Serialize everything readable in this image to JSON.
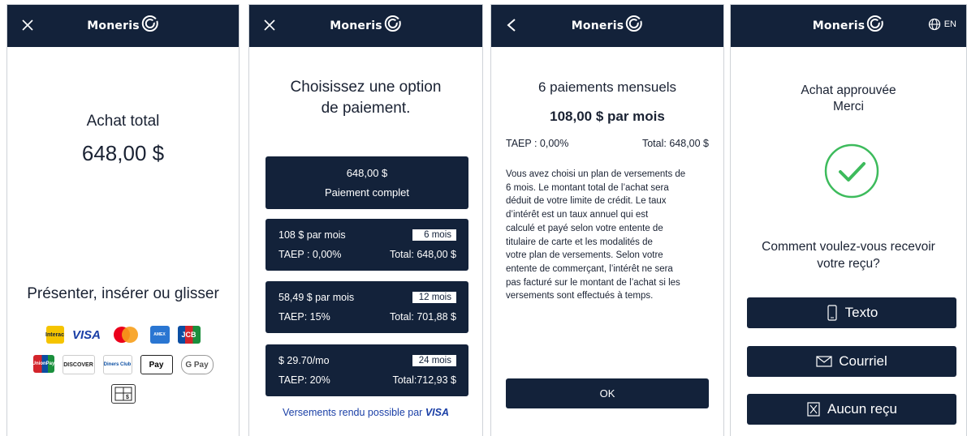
{
  "brand": {
    "name": "Moneris"
  },
  "screen1": {
    "total_label": "Achat total",
    "total_amount": "648,00 $",
    "instruction": "Présenter, insérer ou glisser",
    "card_logos": [
      "Interac",
      "VISA",
      "Mastercard",
      "American Express",
      "JCB",
      "UnionPay",
      "DISCOVER",
      "Diners Club",
      "Apple Pay",
      "G Pay",
      "Gift card"
    ]
  },
  "screen2": {
    "title_line1": "Choisissez une option",
    "title_line2": "de paiement.",
    "full": {
      "amount": "648,00 $",
      "label": "Paiement   complet"
    },
    "options": [
      {
        "monthly": "108 $ par mois",
        "months": "6 mois",
        "rate": "TAEP : 0,00%",
        "total": "Total: 648,00 $"
      },
      {
        "monthly": "58,49 $ par mois",
        "months": "12 mois",
        "rate": "TAEP: 15%",
        "total": "Total: 701,88 $"
      },
      {
        "monthly": "$ 29.70/mo",
        "months": "24 mois",
        "rate": "TAEP: 20%",
        "total": "Total:712,93  $"
      }
    ],
    "footer": "Versements rendu possible par",
    "footer_brand": "VISA"
  },
  "screen3": {
    "title": "6 paiements mensuels",
    "amount": "108,00 $ par mois",
    "rate": "TAEP : 0,00%",
    "total": "Total: 648,00 $",
    "body_lines": [
      "Vous avez choisi un plan de versements de",
      "6 mois. Le montant total de l’achat   sera",
      "déduit de votre limite de crédit. Le taux",
      "d’intérêt est un taux annuel   qui est",
      "calculé et payé selon votre entente de",
      "titulaire de carte et les   modalités de",
      "votre plan de versements. Selon votre",
      "entente de commerçant,   l’intérêt ne sera",
      "pas facturé sur le montant de l’achat si les",
      "versements   sont effectués à temps."
    ],
    "ok_label": "OK"
  },
  "screen4": {
    "lang": "EN",
    "status_line1": "Achat approuvée",
    "status_line2": "Merci",
    "question_line1": "Comment voulez-vous recevoir",
    "question_line2": "votre reçu?",
    "buttons": {
      "text": "Texto",
      "email": "Courriel",
      "none": "Aucun reçu"
    }
  },
  "colors": {
    "navy": "#13223a",
    "success": "#3dbb5c"
  }
}
